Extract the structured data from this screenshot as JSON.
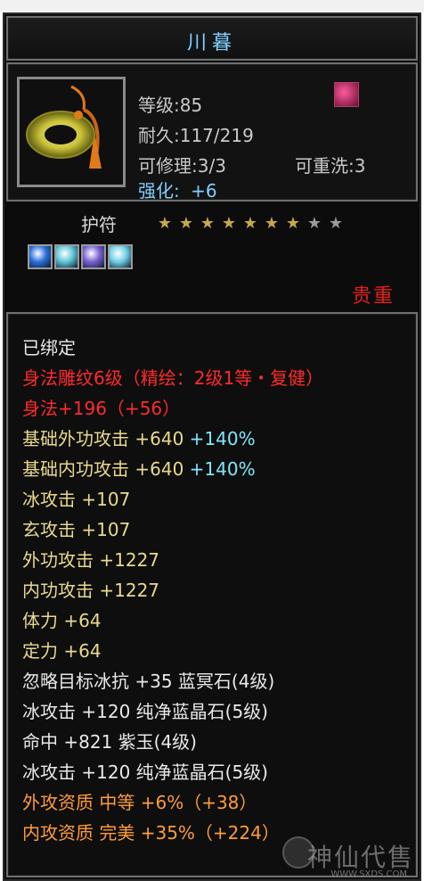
{
  "item": {
    "name": "川暮",
    "level": "等级:85",
    "durability": "耐久:117/219",
    "repairable": "可修理:3/3",
    "rewashable": "可重洗:3",
    "enhance_label": "强化:",
    "enhance_value": "+6",
    "icon": "jade-pendant-icon",
    "badge_icon": "phoenix-badge-icon"
  },
  "type": {
    "label": "护符",
    "stars_filled": 7,
    "stars_total": 9
  },
  "gems": [
    {
      "icon": "blue-gem-icon",
      "color": "#2a6fd8"
    },
    {
      "icon": "cyan-gem-icon",
      "color": "#5fc7d8"
    },
    {
      "icon": "purple-gem-icon",
      "color": "#7b5fd0"
    },
    {
      "icon": "cyan-gem-icon",
      "color": "#6fd0e6"
    }
  ],
  "grade": "贵重",
  "attributes": [
    {
      "segments": [
        {
          "text": "已绑定",
          "color": "white"
        }
      ]
    },
    {
      "segments": [
        {
          "text": "身法雕纹6级（精绘：2级1等・复健）",
          "color": "red"
        }
      ]
    },
    {
      "segments": [
        {
          "text": "身法+196（+56）",
          "color": "red"
        }
      ]
    },
    {
      "segments": [
        {
          "text": "基础外功攻击 +640 ",
          "color": "yellow"
        },
        {
          "text": "+140%",
          "color": "cyan"
        }
      ]
    },
    {
      "segments": [
        {
          "text": "基础内功攻击 +640 ",
          "color": "yellow"
        },
        {
          "text": "+140%",
          "color": "cyan"
        }
      ]
    },
    {
      "segments": [
        {
          "text": "冰攻击 +107",
          "color": "yellow"
        }
      ]
    },
    {
      "segments": [
        {
          "text": "玄攻击 +107",
          "color": "yellow"
        }
      ]
    },
    {
      "segments": [
        {
          "text": "外功攻击 +1227",
          "color": "yellow"
        }
      ]
    },
    {
      "segments": [
        {
          "text": "内功攻击 +1227",
          "color": "yellow"
        }
      ]
    },
    {
      "segments": [
        {
          "text": "体力 +64",
          "color": "yellow"
        }
      ]
    },
    {
      "segments": [
        {
          "text": "定力 +64",
          "color": "yellow"
        }
      ]
    },
    {
      "segments": [
        {
          "text": "忽略目标冰抗 +35 蓝冥石(4级)",
          "color": "white"
        }
      ]
    },
    {
      "segments": [
        {
          "text": "冰攻击 +120 纯净蓝晶石(5级)",
          "color": "white"
        }
      ]
    },
    {
      "segments": [
        {
          "text": "命中 +821 紫玉(4级)",
          "color": "white"
        }
      ]
    },
    {
      "segments": [
        {
          "text": "冰攻击 +120 纯净蓝晶石(5级)",
          "color": "white"
        }
      ]
    },
    {
      "segments": [
        {
          "text": "外攻资质  中等 +6%（+38）",
          "color": "orange"
        }
      ]
    },
    {
      "segments": [
        {
          "text": "内攻资质  完美 +35%（+224）",
          "color": "orange"
        }
      ]
    }
  ],
  "watermark": {
    "text": "神仙代售",
    "url": "WWW.SXDS.COM"
  }
}
